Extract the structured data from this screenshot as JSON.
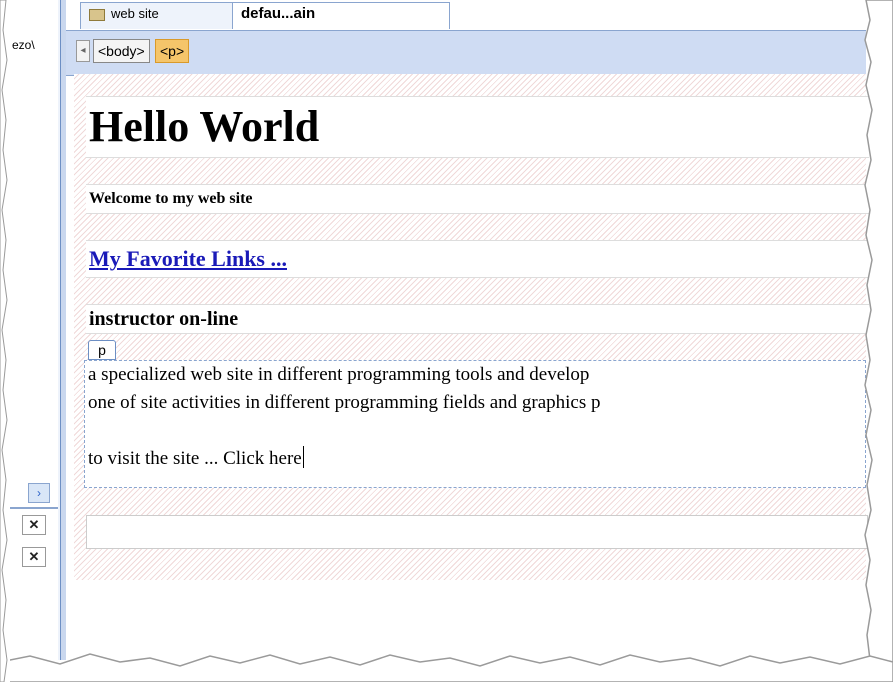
{
  "left_panel": {
    "label": "ezo\\",
    "expand_glyph": "›",
    "close_glyph": "✕"
  },
  "tabs": [
    {
      "label": "web site",
      "icon": "folder-icon"
    },
    {
      "label": "defau...ain"
    }
  ],
  "tagbar": {
    "arrow_glyph": "◂",
    "tags": [
      "<body>",
      "<p>"
    ]
  },
  "content": {
    "heading": "Hello World",
    "welcome": "Welcome to my web site",
    "favorite_links": "My Favorite Links ...",
    "instructor": "instructor on-line",
    "p_badge": "p",
    "paragraph_lines": [
      "a specialized web site in different programming tools and develop",
      "one of site activities in different programming fields and graphics p",
      "",
      "to visit the site ... Click here"
    ]
  },
  "colors": {
    "tag_selected": "#f5c56a",
    "tagbar_bg": "#cfdcf3",
    "link": "#1a1ab8"
  }
}
